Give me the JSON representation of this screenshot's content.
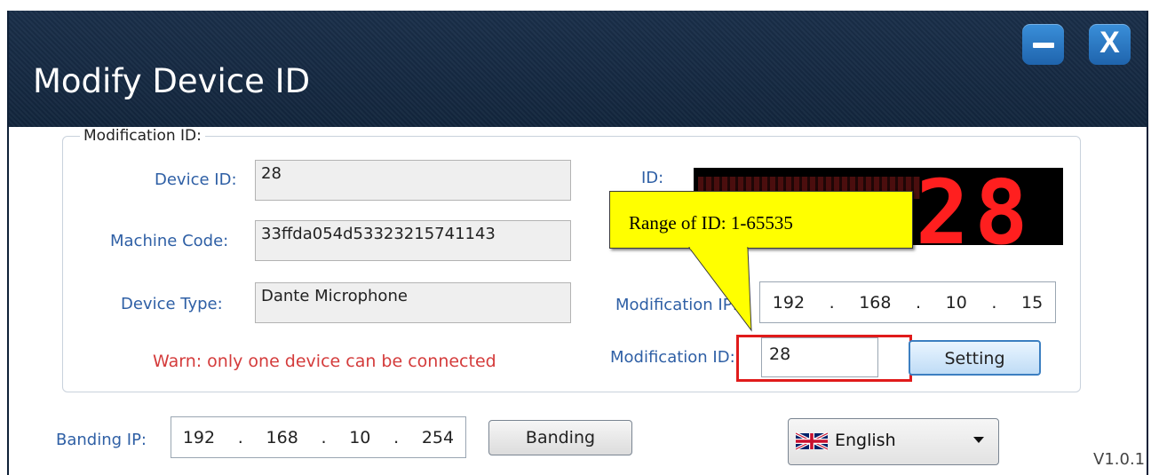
{
  "window": {
    "title": "Modify Device ID",
    "minimize_label": "−",
    "close_label": "X"
  },
  "modification_group": {
    "legend": "Modification ID:",
    "device_id_label": "Device ID:",
    "device_id_value": "28",
    "machine_code_label": "Machine Code:",
    "machine_code_value": "33ffda054d53323215741143",
    "device_type_label": "Device Type:",
    "device_type_value": "Dante Microphone",
    "warning": "Warn: only one device can be connected",
    "id_label": "ID:",
    "id_display": "28",
    "modification_ip_label": "Modification IP:",
    "modification_ip": [
      "192",
      "168",
      "10",
      "15"
    ],
    "modification_id_label": "Modification ID:",
    "modification_id_value": "28",
    "setting_button": "Setting"
  },
  "callout": {
    "text": "Range of ID: 1-65535"
  },
  "bottom": {
    "banding_ip_label": "Banding IP:",
    "banding_ip": [
      "192",
      "168",
      "10",
      "254"
    ],
    "banding_button": "Banding",
    "language": "English",
    "language_icon": "uk-flag-icon",
    "version": "V1.0.1"
  },
  "colors": {
    "titlebar": "#1a2f4a",
    "label_blue": "#2e5fa5",
    "warning_red": "#d43b3b",
    "highlight_red": "#e01b1b",
    "callout_yellow": "#ffff00",
    "display_red": "#ff1f1f"
  }
}
